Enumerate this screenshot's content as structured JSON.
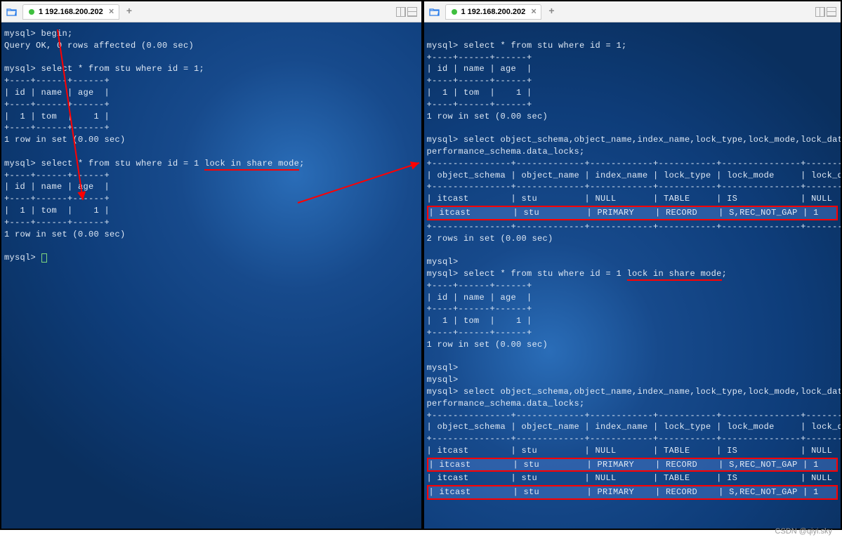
{
  "watermark": "CSDN @qiyi.sky",
  "left": {
    "tab": {
      "label": "1 192.168.200.202"
    },
    "lines": {
      "p0": "mysql> begin;",
      "p1": "Query OK, 0 rows affected (0.00 sec)",
      "blank": " ",
      "p2": "mysql> select * from stu where id = 1;",
      "divider1": "+----+------+------+",
      "hdr": "| id | name | age  |",
      "row": "|  1 | tom  |    1 |",
      "rowsinset": "1 row in set (0.00 sec)",
      "p3a": "mysql> select * from stu where id = 1 ",
      "p3b": "lock in share mode",
      "p3c": ";",
      "prompt": "mysql> "
    }
  },
  "right": {
    "tab": {
      "label": "1 192.168.200.202"
    },
    "lines": {
      "p0": "mysql> select * from stu where id = 1;",
      "divider1": "+----+------+------+",
      "hdr": "| id | name | age  |",
      "row": "|  1 | tom  |    1 |",
      "rowsinset": "1 row in set (0.00 sec)",
      "q1a": "mysql> select object_schema,object_name,index_name,lock_type,lock_mode,lock_data from",
      "q1b": "performance_schema.data_locks;",
      "tdiv": "+---------------+-------------+------------+-----------+---------------+-----------+",
      "thdr": "| object_schema | object_name | index_name | lock_type | lock_mode     | lock_data |",
      "tr1": "| itcast        | stu         | NULL       | TABLE     | IS            | NULL      |",
      "tr2": "| itcast        | stu         | PRIMARY    | RECORD    | S,REC_NOT_GAP | 1         |",
      "tr3": "| itcast        | stu         | NULL       | TABLE     | IS            | NULL      |",
      "tr4": "| itcast        | stu         | PRIMARY    | RECORD    | S,REC_NOT_GAP | 1         |",
      "rows2": "2 rows in set (0.00 sec)",
      "promptEmpty": "mysql>",
      "p2a": "mysql> select * from stu where id = 1 ",
      "p2b": "lock in share mode",
      "p2c": ";"
    }
  }
}
